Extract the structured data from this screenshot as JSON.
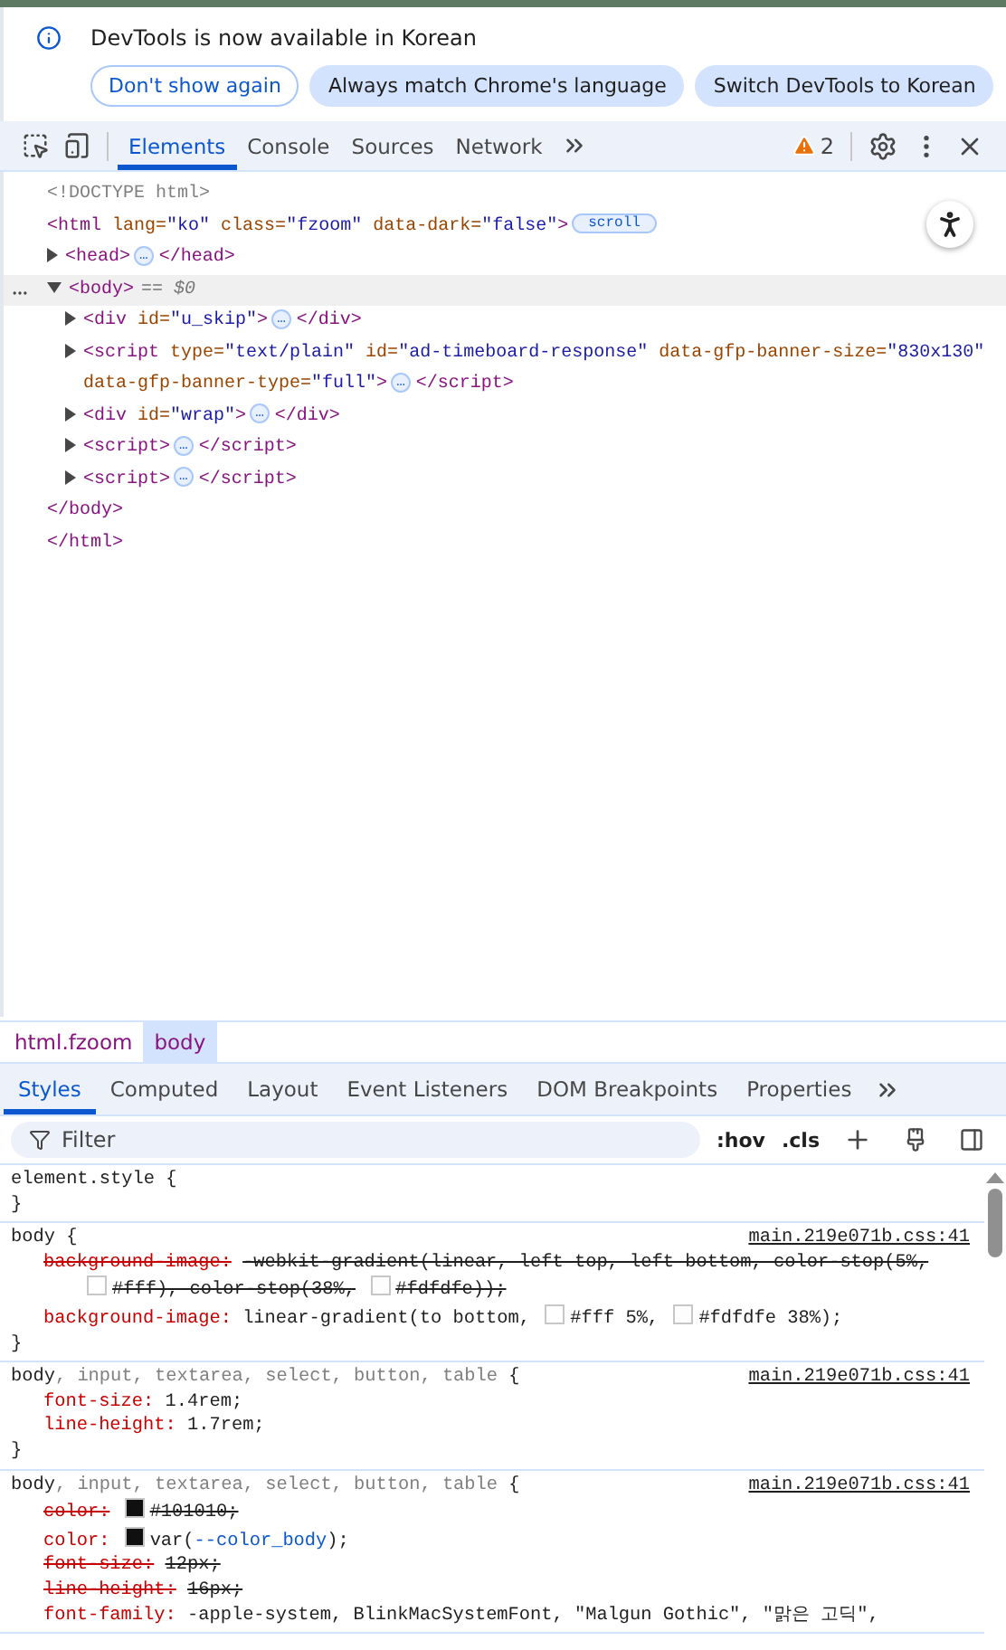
{
  "infobar": {
    "message": "DevTools is now available in Korean",
    "buttons": [
      {
        "label": "Don't show again",
        "kind": "outline"
      },
      {
        "label": "Always match Chrome's language",
        "kind": "filled"
      },
      {
        "label": "Switch DevTools to Korean",
        "kind": "filled"
      }
    ]
  },
  "toolbar": {
    "tabs": [
      {
        "label": "Elements",
        "selected": true
      },
      {
        "label": "Console",
        "selected": false
      },
      {
        "label": "Sources",
        "selected": false
      },
      {
        "label": "Network",
        "selected": false
      }
    ],
    "warnings": "2"
  },
  "dom_tree": [
    {
      "kind": "plain",
      "selected": false,
      "tokens": [
        {
          "kind": "doctype",
          "s": "<!DOCTYPE html>"
        }
      ]
    },
    {
      "kind": "plain",
      "selected": false,
      "tokens": [
        {
          "kind": "tag",
          "s": "<html"
        },
        {
          "kind": "attr",
          "s": " lang="
        },
        {
          "kind": "val",
          "s": "\"ko\""
        },
        {
          "kind": "attr",
          "s": " class="
        },
        {
          "kind": "val",
          "s": "\"fzoom\""
        },
        {
          "kind": "attr",
          "s": " data-dark="
        },
        {
          "kind": "val",
          "s": "\"false\""
        },
        {
          "kind": "tag",
          "s": ">"
        }
      ],
      "badge": {
        "kind": "label",
        "s": "scroll"
      },
      "end": "</html>",
      "children": [
        {
          "kind": "toggle",
          "expanded": false,
          "selected": false,
          "tokens": [
            {
              "kind": "tag",
              "s": "<head>"
            }
          ],
          "badge": {
            "kind": "dots",
            "s": "…"
          },
          "close": "</head>"
        },
        {
          "kind": "toggle",
          "expanded": true,
          "selected": true,
          "tokens": [
            {
              "kind": "tag",
              "s": "<body>"
            }
          ],
          "suffix": "== $0",
          "end": "</body>",
          "children": [
            {
              "kind": "toggle",
              "expanded": false,
              "selected": false,
              "tokens": [
                {
                  "kind": "tag",
                  "s": "<div"
                },
                {
                  "kind": "attr",
                  "s": " id="
                },
                {
                  "kind": "val",
                  "s": "\"u_skip\""
                },
                {
                  "kind": "tag",
                  "s": ">"
                }
              ],
              "badge": {
                "kind": "dots",
                "s": "…"
              },
              "close": "</div>"
            },
            {
              "kind": "toggle",
              "expanded": false,
              "selected": false,
              "tokens": [
                {
                  "kind": "tag",
                  "s": "<script"
                },
                {
                  "kind": "attr",
                  "s": " type="
                },
                {
                  "kind": "val",
                  "s": "\"text/plain\""
                },
                {
                  "kind": "attr",
                  "s": " id="
                },
                {
                  "kind": "val",
                  "s": "\"ad-timeboard-response\""
                },
                {
                  "kind": "attr",
                  "s": " data-gfp-banner-size="
                },
                {
                  "kind": "val",
                  "s": "\"830x130\""
                }
              ],
              "tokens_line_2": [
                {
                  "kind": "attr",
                  "s": "data-gfp-banner-type="
                },
                {
                  "kind": "val",
                  "s": "\"full\""
                },
                {
                  "kind": "tag",
                  "s": ">"
                }
              ],
              "badge": {
                "kind": "dots",
                "s": "…"
              },
              "close": "</script>"
            },
            {
              "kind": "toggle",
              "expanded": false,
              "selected": false,
              "tokens": [
                {
                  "kind": "tag",
                  "s": "<div"
                },
                {
                  "kind": "attr",
                  "s": " id="
                },
                {
                  "kind": "val",
                  "s": "\"wrap\""
                },
                {
                  "kind": "tag",
                  "s": ">"
                }
              ],
              "badge": {
                "kind": "dots",
                "s": "…"
              },
              "close": "</div>"
            },
            {
              "kind": "toggle",
              "expanded": false,
              "selected": false,
              "tokens": [
                {
                  "kind": "tag",
                  "s": "<script>"
                }
              ],
              "badge": {
                "kind": "dots",
                "s": "…"
              },
              "close": "</script>"
            },
            {
              "kind": "toggle",
              "expanded": false,
              "selected": false,
              "tokens": [
                {
                  "kind": "tag",
                  "s": "<script>"
                }
              ],
              "badge": {
                "kind": "dots",
                "s": "…"
              },
              "close": "</script>"
            }
          ]
        }
      ]
    }
  ],
  "breadcrumbs": [
    {
      "label": "html.fzoom",
      "selected": false
    },
    {
      "label": "body",
      "selected": true
    }
  ],
  "styles_tabs": [
    {
      "label": "Styles",
      "selected": true
    },
    {
      "label": "Computed",
      "selected": false
    },
    {
      "label": "Layout",
      "selected": false
    },
    {
      "label": "Event Listeners",
      "selected": false
    },
    {
      "label": "DOM Breakpoints",
      "selected": false
    },
    {
      "label": "Properties",
      "selected": false
    }
  ],
  "filter": {
    "placeholder": "Filter",
    "hov": ":hov",
    "cls": ".cls"
  },
  "rules": [
    {
      "selector": [
        {
          "s": "element.style",
          "matched": true
        }
      ],
      "open": "{",
      "close": "}"
    },
    {
      "selector": [
        {
          "s": "body",
          "matched": true
        }
      ],
      "open": "{",
      "close": "}",
      "source": "main.219e071b.css:41",
      "decls": [
        {
          "prop": "background-image:",
          "overridden": true,
          "value": [
            {
              "kind": "text",
              "s": "-webkit-gradient(linear, left top, left bottom, color-stop(5%,"
            },
            {
              "kind": "swatch",
              "color": "#ffffff",
              "s": "#fff), color-stop(38%,"
            },
            {
              "kind": "swatch",
              "color": "#fdfdfe",
              "s": "#fdfdfe));"
            }
          ]
        },
        {
          "prop": "background-image:",
          "overridden": false,
          "value": [
            {
              "kind": "text",
              "s": "linear-gradient(to bottom,"
            },
            {
              "kind": "swatch",
              "color": "#ffffff",
              "s": "#fff 5%,"
            },
            {
              "kind": "swatch",
              "color": "#fdfdfe",
              "s": "#fdfdfe 38%);"
            }
          ]
        }
      ]
    },
    {
      "selector": [
        {
          "s": "body",
          "matched": true
        },
        {
          "s": ", input, textarea, select, button, table",
          "matched": false
        }
      ],
      "open": "{",
      "close": "}",
      "source": "main.219e071b.css:41",
      "decls": [
        {
          "prop": "font-size:",
          "overridden": false,
          "value": [
            {
              "kind": "text",
              "s": "1.4rem;"
            }
          ]
        },
        {
          "prop": "line-height:",
          "overridden": false,
          "value": [
            {
              "kind": "text",
              "s": "1.7rem;"
            }
          ]
        }
      ]
    },
    {
      "selector": [
        {
          "s": "body",
          "matched": true
        },
        {
          "s": ", input, textarea, select, button, table",
          "matched": false
        }
      ],
      "open": "{",
      "source": "main.219e071b.css:41",
      "decls": [
        {
          "prop": "color:",
          "overridden": true,
          "value": [
            {
              "kind": "swatch",
              "color": "#101010",
              "s": "#101010;"
            }
          ]
        },
        {
          "prop": "color:",
          "overridden": false,
          "value": [
            {
              "kind": "swatch",
              "color": "#101010",
              "s": "var("
            },
            {
              "kind": "var",
              "s": "--color_body"
            },
            {
              "kind": "text",
              "s": ");"
            }
          ]
        },
        {
          "prop": "font-size:",
          "overridden": true,
          "value": [
            {
              "kind": "text",
              "s": "12px;"
            }
          ]
        },
        {
          "prop": "line-height:",
          "overridden": true,
          "value": [
            {
              "kind": "text",
              "s": "16px;"
            }
          ]
        },
        {
          "prop": "font-family:",
          "overridden": false,
          "value": [
            {
              "kind": "text",
              "s": "-apple-system, BlinkMacSystemFont, \"Malgun Gothic\", \"맑은 고딕\","
            }
          ]
        }
      ]
    }
  ]
}
